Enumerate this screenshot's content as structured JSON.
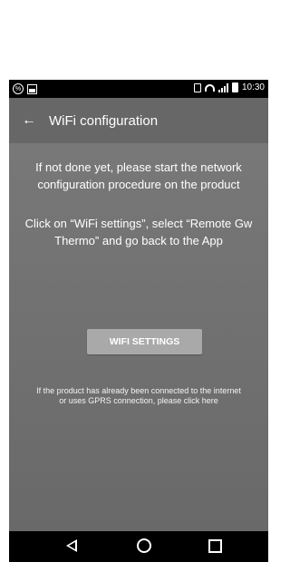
{
  "status_bar": {
    "time": "10:30",
    "left_icons": [
      "settings-badge-icon",
      "gallery-icon"
    ],
    "right_icons": [
      "vibrate-icon",
      "wifi-icon",
      "signal-icon",
      "battery-icon"
    ]
  },
  "app_bar": {
    "back_icon": "arrow-left-icon",
    "title": "WiFi configuration"
  },
  "main": {
    "intro_text": "If not done yet, please start the network configuration procedure on the product",
    "instruction_text": "Click on “WiFi settings”, select “Remote Gw Thermo” and go back to the App",
    "wifi_settings_button": "WiFi SETTINGS",
    "already_connected_link": "If the product has already been connected to the internet or uses GPRS connection, please click here"
  },
  "navigation": {
    "items": [
      "back-icon",
      "home-icon",
      "recent-apps-icon"
    ]
  },
  "colors": {
    "app_bar": "#676767",
    "content": "#737373",
    "button": "#a9a9a9",
    "system_bars": "#000000"
  }
}
